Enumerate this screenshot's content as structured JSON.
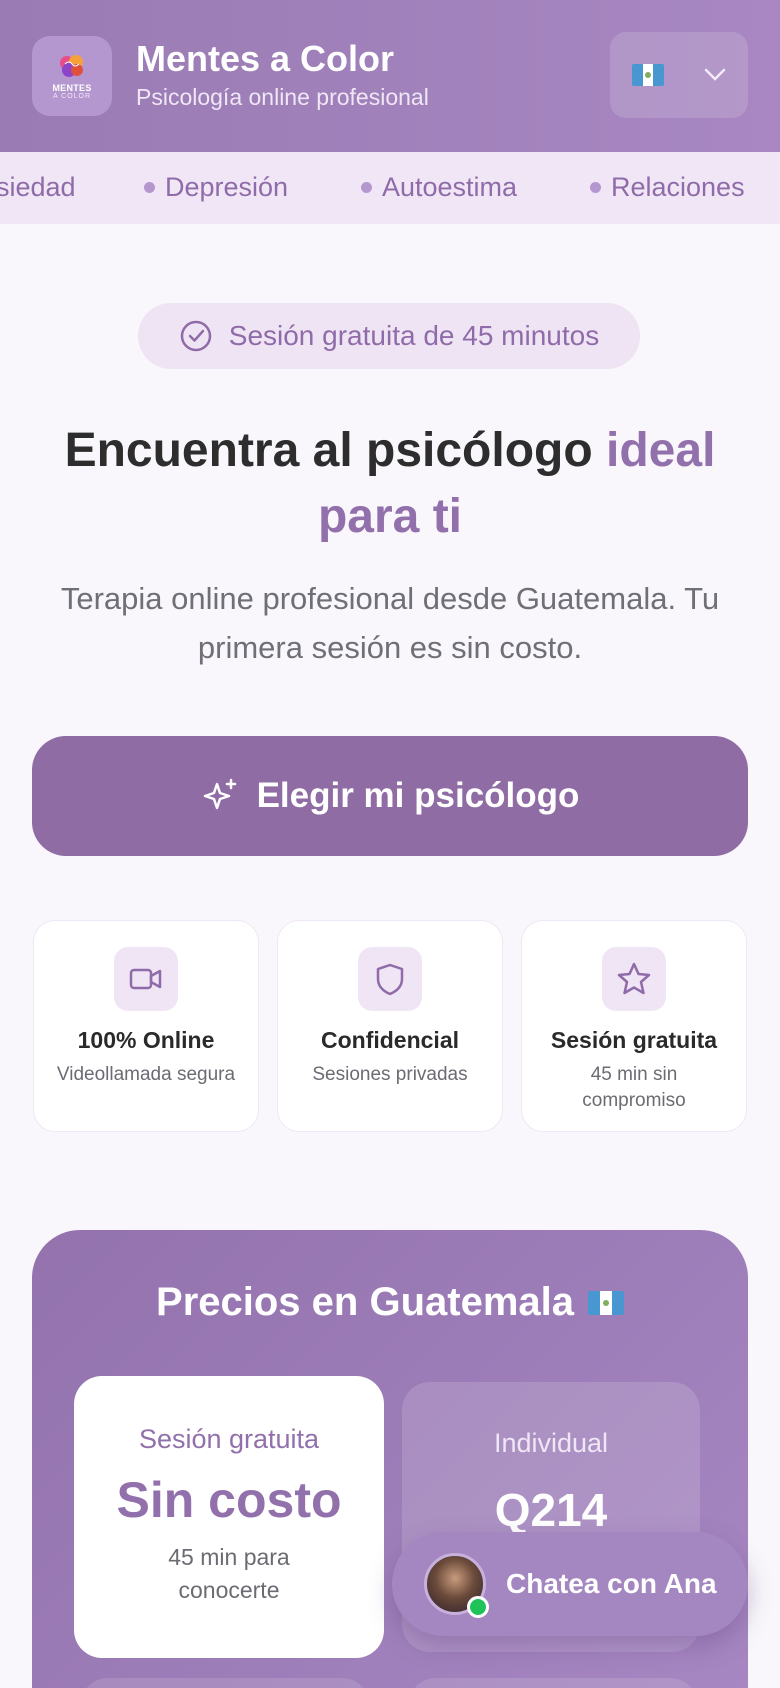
{
  "header": {
    "logo_text": "MENTES",
    "logo_sub": "A COLOR",
    "title": "Mentes a Color",
    "subtitle": "Psicología online profesional",
    "language_flag_icon": "guatemala-flag-icon",
    "dropdown_icon": "chevron-down-icon"
  },
  "ticker": {
    "items": [
      "siedad",
      "Depresión",
      "Autoestima",
      "Relaciones"
    ]
  },
  "badge": {
    "label": "Sesión gratuita de 45 minutos",
    "icon": "check-circle-icon"
  },
  "hero": {
    "title_part1": "Encuentra al psicólogo ",
    "title_accent": "ideal para ti",
    "subtitle": "Terapia online profesional desde Guatemala. Tu primera sesión es sin costo."
  },
  "cta": {
    "label": "Elegir mi psicólogo",
    "icon": "sparkles-icon"
  },
  "features": [
    {
      "title": "100% Online",
      "desc": "Videollamada segura",
      "icon": "video-icon"
    },
    {
      "title": "Confidencial",
      "desc": "Sesiones privadas",
      "icon": "shield-icon"
    },
    {
      "title": "Sesión gratuita",
      "desc": "45 min sin compromiso",
      "icon": "star-icon"
    }
  ],
  "pricing": {
    "title": "Precios en Guatemala",
    "free": {
      "label": "Sesión gratuita",
      "value": "Sin costo",
      "desc": "45 min para conocerte"
    },
    "individual": {
      "label": "Individual",
      "value": "Q214"
    }
  },
  "chat": {
    "label": "Chatea con Ana",
    "status": "online"
  },
  "colors": {
    "primary": "#8f6ca4",
    "accent": "#9270ab",
    "header": "#a887c2",
    "online": "#1fc35a"
  }
}
